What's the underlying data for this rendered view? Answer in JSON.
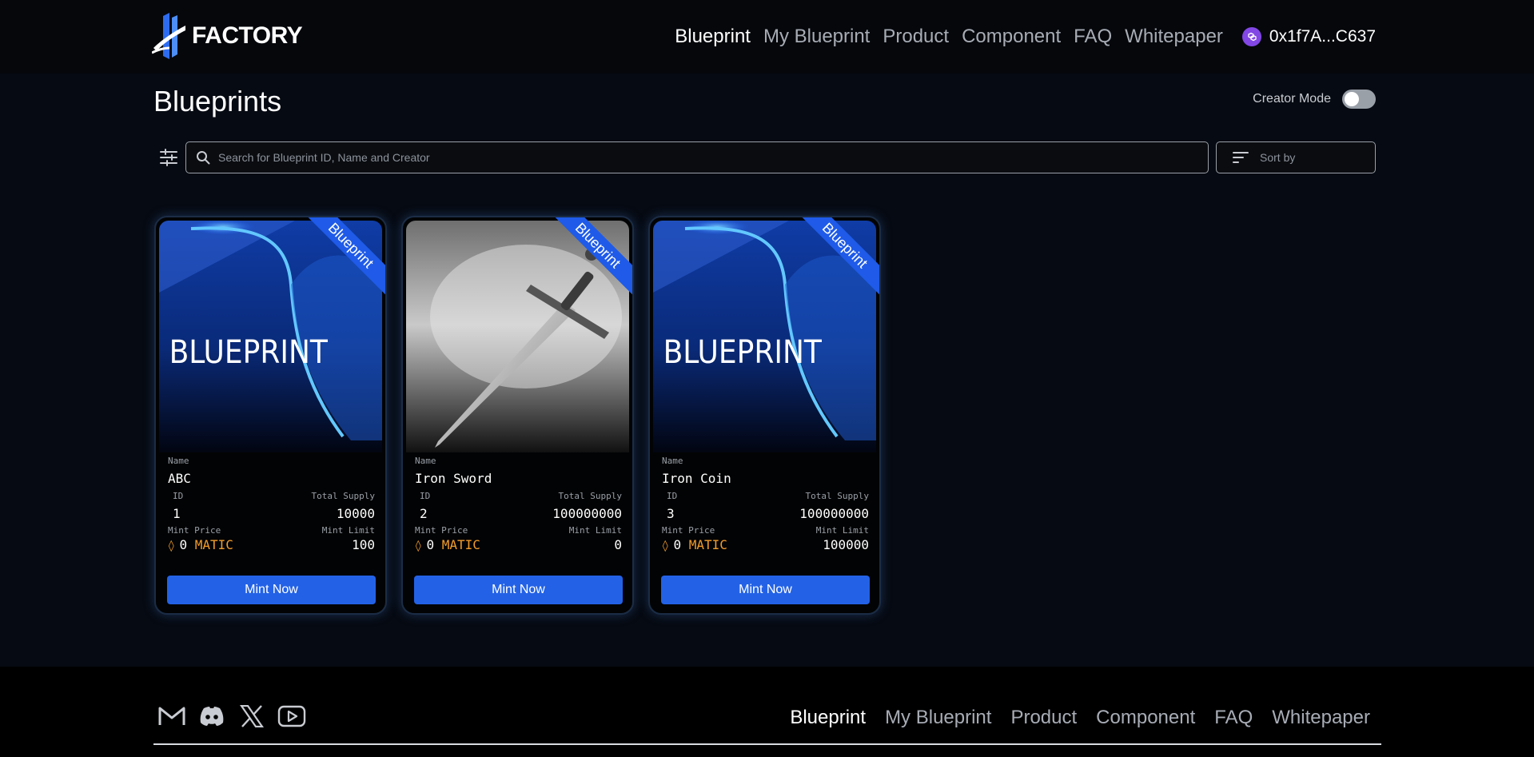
{
  "brand": {
    "name": "FACTORY"
  },
  "nav": {
    "items": [
      {
        "label": "Blueprint",
        "active": true
      },
      {
        "label": "My Blueprint",
        "active": false
      },
      {
        "label": "Product",
        "active": false
      },
      {
        "label": "Component",
        "active": false
      },
      {
        "label": "FAQ",
        "active": false
      },
      {
        "label": "Whitepaper",
        "active": false
      }
    ],
    "wallet": {
      "address": "0x1f7A...C637",
      "icon": "polygon-icon"
    }
  },
  "page": {
    "title": "Blueprints",
    "creator_mode_label": "Creator Mode",
    "creator_mode_on": false
  },
  "search": {
    "placeholder": "Search for Blueprint ID, Name and Creator",
    "value": ""
  },
  "sort": {
    "label": "Sort by"
  },
  "card_labels": {
    "name": "Name",
    "id": "ID",
    "total_supply": "Total Supply",
    "mint_price": "Mint Price",
    "mint_limit": "Mint Limit",
    "ribbon": "Blueprint",
    "button": "Mint Now",
    "currency": "MATIC",
    "image_text": "BLUEPRINT"
  },
  "cards": [
    {
      "name": "ABC",
      "id": "1",
      "total_supply": "10000",
      "mint_price": "0",
      "mint_limit": "100",
      "image": "blueprint-artwork"
    },
    {
      "name": "Iron Sword",
      "id": "2",
      "total_supply": "100000000",
      "mint_price": "0",
      "mint_limit": "0",
      "image": "sword-artwork"
    },
    {
      "name": "Iron Coin",
      "id": "3",
      "total_supply": "100000000",
      "mint_price": "0",
      "mint_limit": "100000",
      "image": "blueprint-artwork"
    }
  ],
  "footer": {
    "socials": [
      "gmail-icon",
      "discord-icon",
      "x-icon",
      "youtube-icon"
    ],
    "nav": [
      {
        "label": "Blueprint",
        "active": true
      },
      {
        "label": "My Blueprint",
        "active": false
      },
      {
        "label": "Product",
        "active": false
      },
      {
        "label": "Component",
        "active": false
      },
      {
        "label": "FAQ",
        "active": false
      },
      {
        "label": "Whitepaper",
        "active": false
      }
    ]
  },
  "colors": {
    "accent": "#2362e6",
    "ribbon": "#1f5be8",
    "currency": "#f39c2b",
    "background": "#060a12"
  }
}
